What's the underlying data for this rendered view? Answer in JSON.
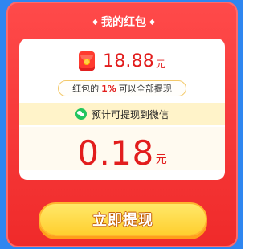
{
  "title": "我的红包",
  "balance": {
    "amount": "18.88",
    "unit": "元"
  },
  "rule": {
    "prefix": "红包的",
    "percent": "1%",
    "suffix": "可以全部提现"
  },
  "wechat": {
    "label": "预计可提现到微信"
  },
  "estimate": {
    "amount": "0.18",
    "unit": "元"
  },
  "action": {
    "label": "立即提现"
  },
  "colors": {
    "primary_red": "#e21d1d",
    "card_red": "#ef2a2a",
    "blue_bg": "#2f86f0",
    "button_yellow": "#ffd23a",
    "wechat_green": "#22c55e"
  },
  "icons": {
    "balance": "red-packet-icon",
    "wechat": "wechat-icon"
  }
}
